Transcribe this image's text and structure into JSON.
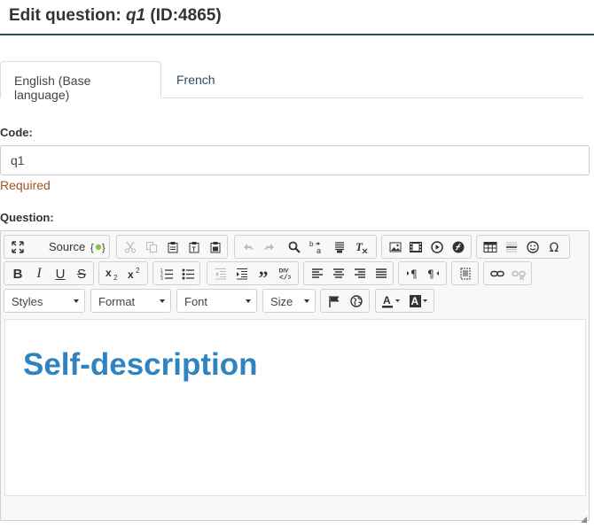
{
  "page": {
    "title_prefix": "Edit question:",
    "question_code": "q1",
    "question_id": "(ID:4865)"
  },
  "tabs": [
    {
      "label": "English (Base language)",
      "active": true
    },
    {
      "label": "French",
      "active": false
    }
  ],
  "form": {
    "code_label": "Code:",
    "code_value": "q1",
    "code_hint": "Required",
    "question_label": "Question:"
  },
  "editor": {
    "toolbar": {
      "source_label": "Source",
      "styles_label": "Styles",
      "format_label": "Format",
      "font_label": "Font",
      "size_label": "Size"
    },
    "content_heading": "Self-description"
  },
  "colors": {
    "header_border": "#2d4a56",
    "tab_link": "#2d4a66",
    "required_text": "#a0522d",
    "content_heading": "#2e84c0"
  }
}
